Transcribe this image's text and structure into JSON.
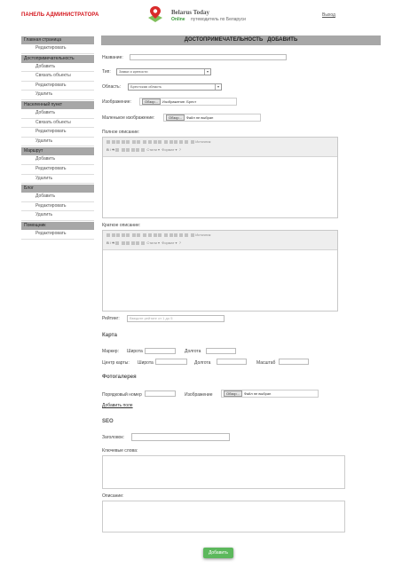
{
  "header": {
    "admin_title": "ПАНЕЛЬ АДМИНИСТРАТОРА",
    "brand": "Belarus Today",
    "online": "Online",
    "tagline": "путеводитель по Беларуси",
    "logout": "Выход"
  },
  "sidebar": {
    "groups": [
      {
        "title": "Главная страница",
        "items": [
          "Редактировать"
        ]
      },
      {
        "title": "Достопримечательность",
        "items": [
          "Добавить",
          "Связать объекты",
          "Редактировать",
          "Удалить"
        ]
      },
      {
        "title": "Населенный пункт",
        "items": [
          "Добавить",
          "Связать объекты",
          "Редактировать",
          "Удалить"
        ]
      },
      {
        "title": "Маршрут",
        "items": [
          "Добавить",
          "Редактировать",
          "Удалить"
        ]
      },
      {
        "title": "Блог",
        "items": [
          "Добавить",
          "Редактировать",
          "Удалить"
        ]
      },
      {
        "title": "Помощник",
        "items": [
          "Редактировать"
        ]
      }
    ]
  },
  "main": {
    "title": "ДОСТОПРИМЕЧАТЕЛЬНОСТЬ",
    "title_action": "ДОБАВИТЬ",
    "name_label": "Название:",
    "type_label": "Тип:",
    "type_value": "Замки и крепости",
    "region_label": "Область:",
    "region_value": "Брестская область",
    "image_label": "Изображение:",
    "image_button": "Обзор...",
    "image_value": "Изображение. Брест",
    "small_image_label": "Маленькое изображение:",
    "small_image_button": "Обзор...",
    "small_image_value": "Файл не выбран",
    "full_desc_label": "Полное описание:",
    "short_desc_label": "Краткое описание:",
    "editor_style": "Стили",
    "editor_format": "Формат",
    "editor_source": "Источник",
    "rating_label": "Рейтинг:",
    "rating_placeholder": "Введите рейтинг от 1 до 5",
    "map_title": "Карта",
    "marker_label": "Маркер:",
    "latitude_label": "Широта",
    "longitude_label": "Долгота",
    "map_center_label": "Центр карты:",
    "center_lat_label": "Широта",
    "center_lon_label": "Долгота",
    "scale_label": "Масштаб",
    "gallery_title": "Фотогалерея",
    "order_label": "Порядковый номер",
    "gallery_image_label": "Изображение",
    "gallery_button": "Обзор...",
    "gallery_value": "Файл не выбран",
    "add_more_link": "Добавить поле",
    "seo_title": "SEO",
    "seo_heading_label": "Заголовок:",
    "keywords_label": "Ключевые слова:",
    "description_label": "Описание:",
    "submit": "Добавить"
  }
}
